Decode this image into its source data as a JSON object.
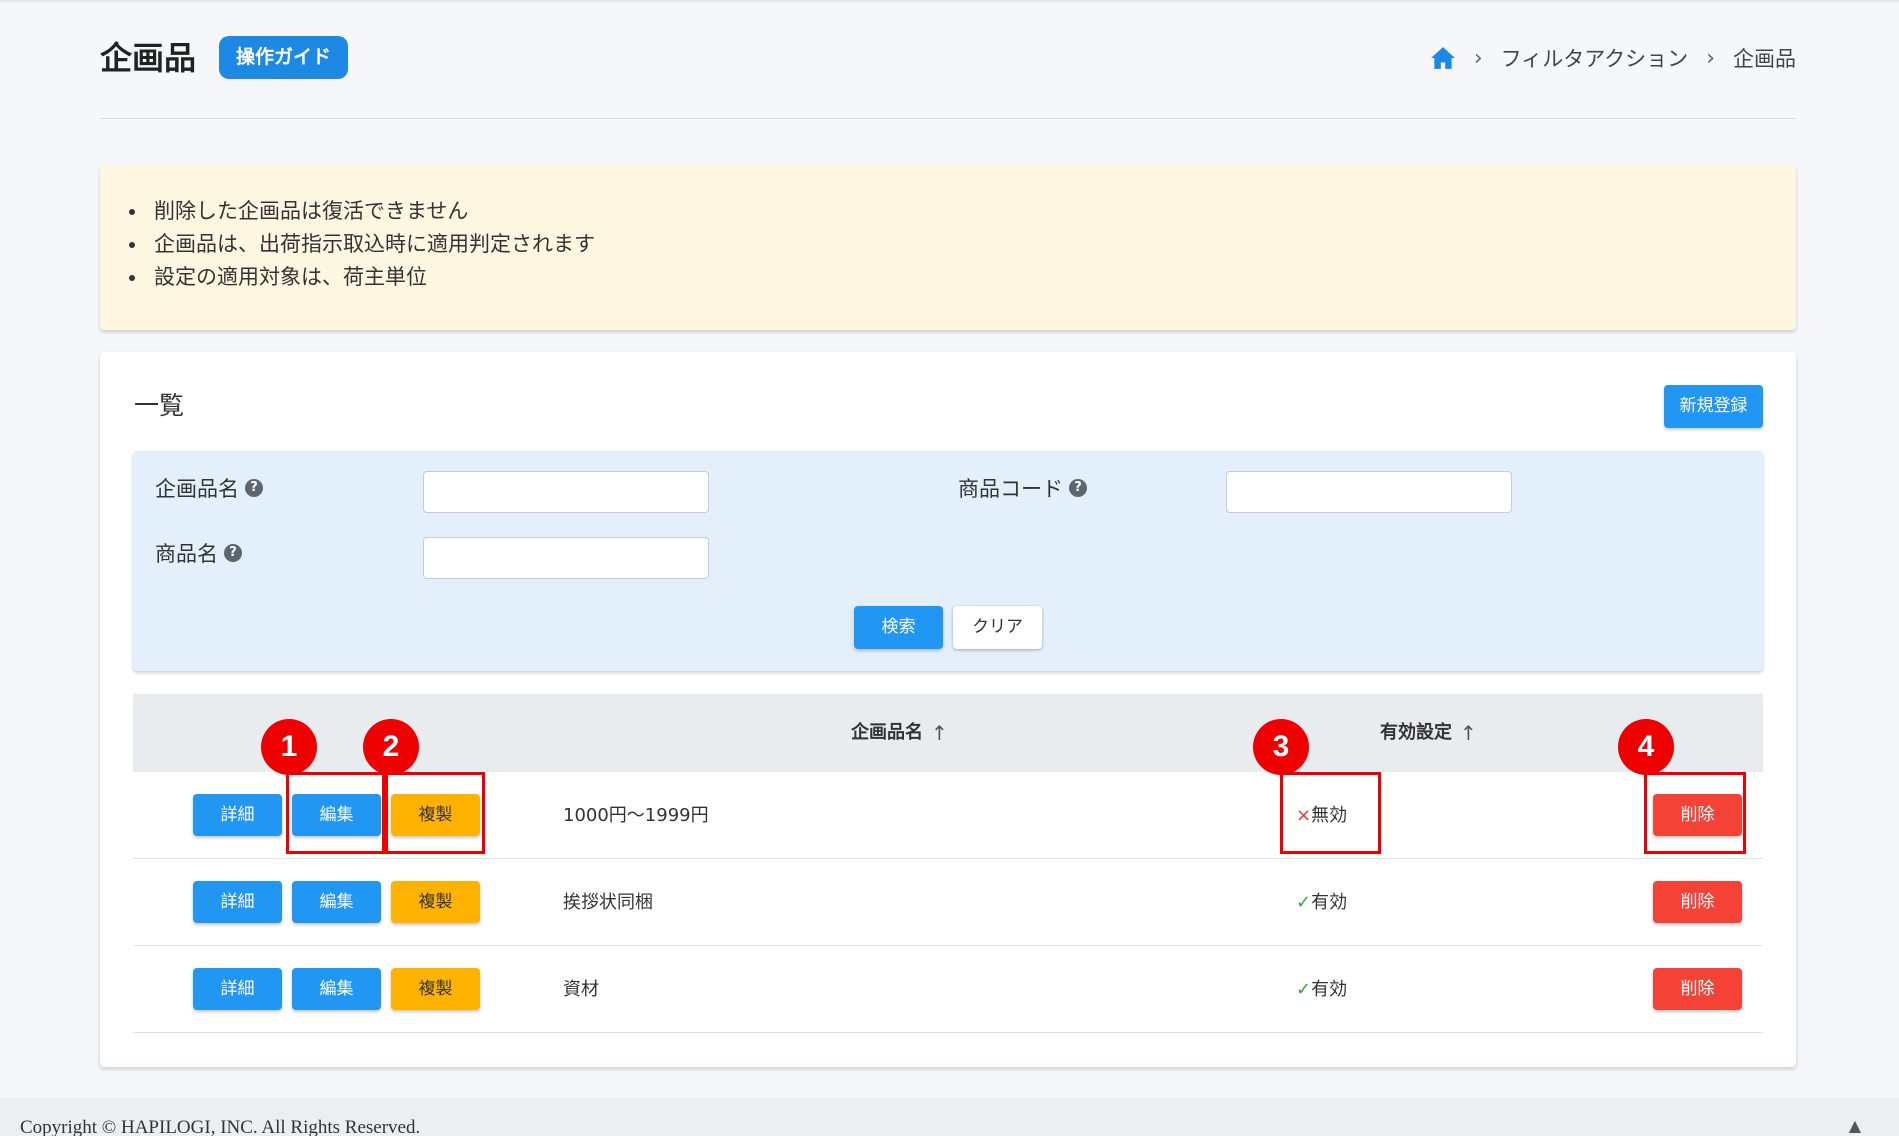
{
  "header": {
    "title": "企画品",
    "guide_label": "操作ガイド",
    "breadcrumb": [
      "フィルタアクション",
      "企画品"
    ]
  },
  "notice": {
    "items": [
      "削除した企画品は復活できません",
      "企画品は、出荷指示取込時に適用判定されます",
      "設定の適用対象は、荷主単位"
    ]
  },
  "list": {
    "title": "一覧",
    "new_button": "新規登録"
  },
  "search": {
    "fields": [
      {
        "label": "企画品名",
        "value": ""
      },
      {
        "label": "商品コード",
        "value": ""
      },
      {
        "label": "商品名",
        "value": ""
      }
    ],
    "search_button": "検索",
    "clear_button": "クリア"
  },
  "table": {
    "columns": [
      "企画品名",
      "有効設定"
    ],
    "buttons": {
      "detail": "詳細",
      "edit": "編集",
      "copy": "複製",
      "delete": "削除"
    },
    "rows": [
      {
        "name": "1000円～1999円",
        "status": "無効",
        "mark": "×"
      },
      {
        "name": "挨拶状同梱",
        "status": "有効",
        "mark": "✓"
      },
      {
        "name": "資材",
        "status": "有効",
        "mark": "✓"
      }
    ]
  },
  "callouts": [
    "1",
    "2",
    "3",
    "4"
  ],
  "footer": {
    "copyright": "Copyright © HAPILOGI, INC. All Rights Reserved."
  },
  "colors": {
    "primary": "#2196f3",
    "warning": "#ffb300",
    "danger": "#f44336",
    "annotation": "#ee0000",
    "notice_bg": "#fdf7e1",
    "search_bg": "#e3f0fb"
  },
  "icons": [
    "home-icon",
    "chevron-right-icon",
    "help-icon",
    "sort-arrow-icon",
    "cross-icon",
    "check-icon",
    "scroll-top-icon"
  ]
}
